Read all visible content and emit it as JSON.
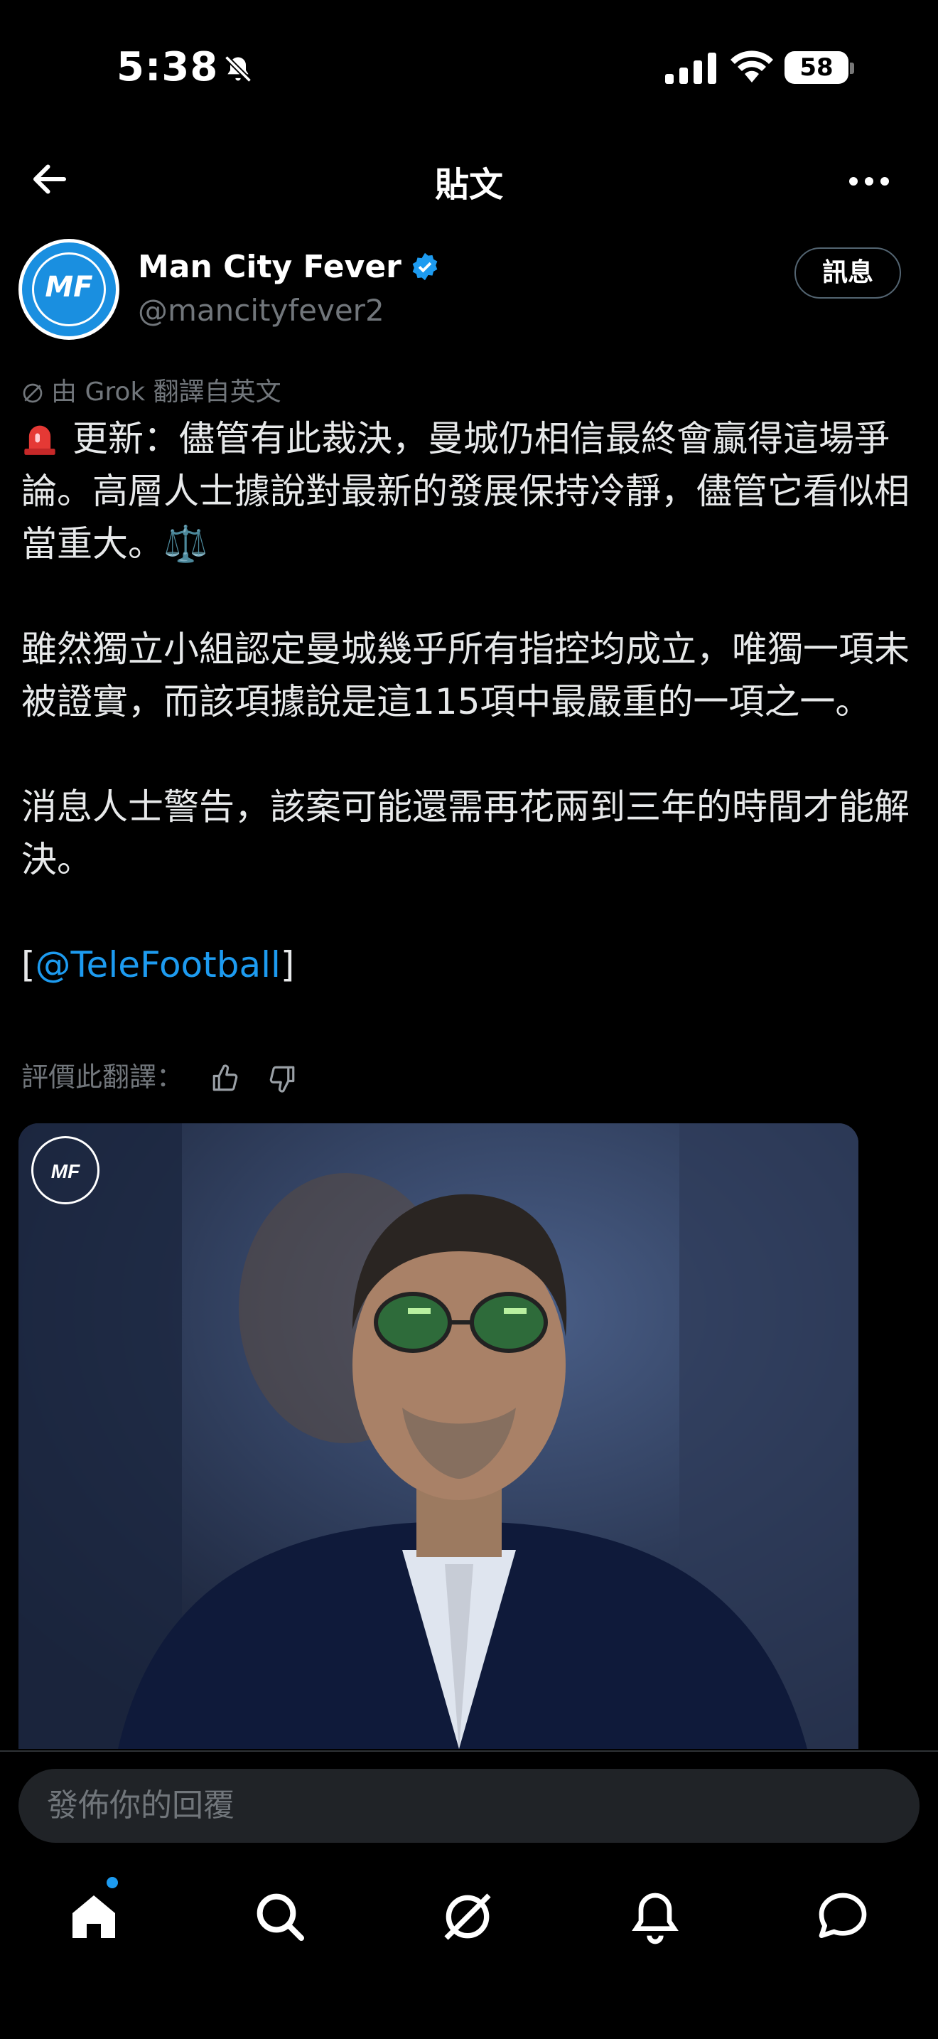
{
  "status_bar": {
    "time": "5:38",
    "battery": "58"
  },
  "header": {
    "title": "貼文"
  },
  "author": {
    "name": "Man City Fever",
    "handle": "@mancityfever2",
    "message_button": "訊息",
    "avatar_text": "MF"
  },
  "translation_note": "由 Grok 翻譯自英文",
  "post": {
    "line1": "更新：儘管有此裁決，曼城仍相信最終會贏得這場爭論。高層人士據說對最新的發展保持冷靜，儘管它看似相當重大。⚖️",
    "line2": "雖然獨立小組認定曼城幾乎所有指控均成立，唯獨一項未被證實，而該項據說是這115項中最嚴重的一項之一。",
    "line3": "消息人士警告，該案可能還需再花兩到三年的時間才能解決。",
    "mention_open": "[",
    "mention": "@TeleFootball",
    "mention_close": "]"
  },
  "rate_translation": "評價此翻譯：",
  "reply": {
    "placeholder": "發佈你的回覆"
  },
  "tabs": [
    "home-icon",
    "search-icon",
    "grok-icon",
    "notifications-icon",
    "messages-icon"
  ],
  "colors": {
    "accent": "#1d9bf0",
    "background": "#000000",
    "muted": "#71767b"
  }
}
